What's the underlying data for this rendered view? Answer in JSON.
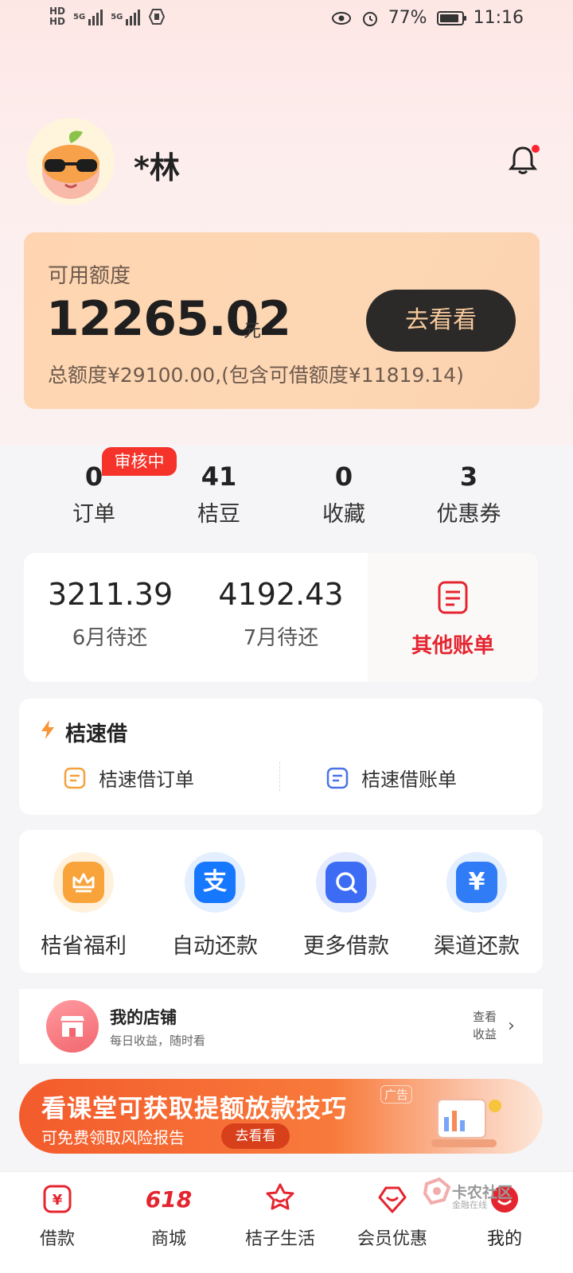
{
  "status_bar": {
    "left_text": "HD",
    "network": "5G",
    "battery": "77%",
    "battery_level": 0.77,
    "time": "11:16"
  },
  "profile": {
    "username": "*林",
    "icons": {
      "avatar": "orange-mascot-sunglasses",
      "notification": "bell-icon"
    }
  },
  "credit": {
    "label": "可用额度",
    "amount": "12265.02",
    "unit": "元",
    "total": "总额度¥29100.00,(包含可借额度¥11819.14)",
    "button": "去看看"
  },
  "stats": {
    "badge": "审核中",
    "items": [
      {
        "value": "0",
        "label": "订单"
      },
      {
        "value": "41",
        "label": "桔豆"
      },
      {
        "value": "0",
        "label": "收藏"
      },
      {
        "value": "3",
        "label": "优惠券"
      }
    ]
  },
  "bills": {
    "items": [
      {
        "amount": "3211.39",
        "label": "6月待还"
      },
      {
        "amount": "4192.43",
        "label": "7月待还"
      }
    ],
    "other_label": "其他账单"
  },
  "speed_loan": {
    "title": "桔速借",
    "order_label": "桔速借订单",
    "bill_label": "桔速借账单"
  },
  "quick_actions": [
    {
      "label": "桔省福利",
      "icon": "crown-icon",
      "color": "#f9a43b"
    },
    {
      "label": "自动还款",
      "icon": "alipay-icon",
      "color": "#1677ff"
    },
    {
      "label": "更多借款",
      "icon": "search-icon",
      "color": "#3b6cf3"
    },
    {
      "label": "渠道还款",
      "icon": "yen-icon",
      "color": "#2f7cf6"
    }
  ],
  "shop": {
    "title": "我的店铺",
    "subtitle": "每日收益，随时看",
    "link_line1": "查看",
    "link_line2": "收益"
  },
  "ad": {
    "title": "看课堂可获取提额放款技巧",
    "subtitle": "可免费领取风险报告",
    "button": "去看看",
    "tag": "广告"
  },
  "tabbar": {
    "items": [
      {
        "label": "借款",
        "icon": "loan-icon"
      },
      {
        "label": "商城",
        "icon": "618-icon"
      },
      {
        "label": "桔子生活",
        "icon": "life-icon"
      },
      {
        "label": "会员优惠",
        "icon": "member-icon"
      },
      {
        "label": "我的",
        "icon": "profile-icon"
      }
    ],
    "mall_badge": "618"
  },
  "watermark": {
    "text": "卡农社区",
    "sub": "金融在线"
  },
  "colors": {
    "accent": "#e4252f",
    "card": "#fed5b0",
    "button_dark": "#2b2a28",
    "button_text": "#f7c99c"
  }
}
